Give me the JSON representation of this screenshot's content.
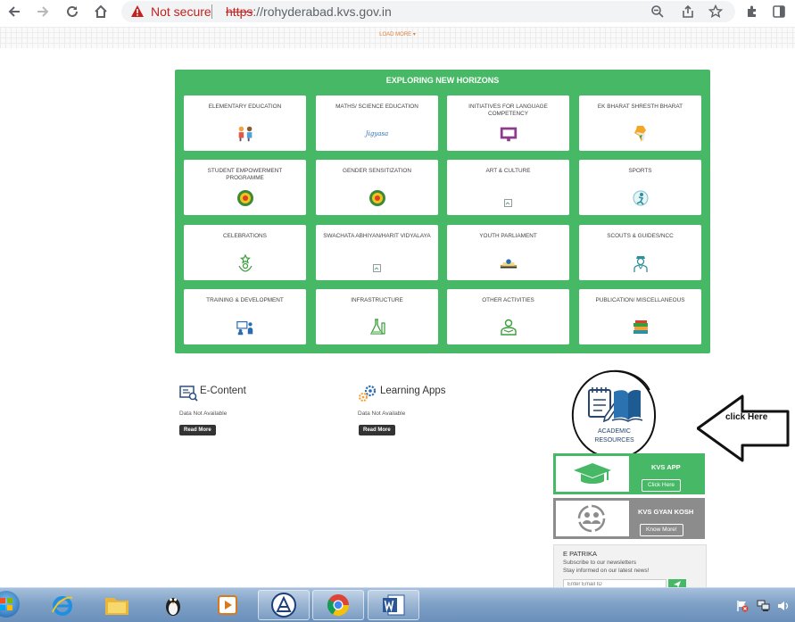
{
  "browser": {
    "security_label": "Not secure",
    "url_scheme": "https",
    "url_rest": "://rohyderabad.kvs.gov.in"
  },
  "load_more": "LOAD MORE ▾",
  "panel": {
    "title": "EXPLORING NEW HORIZONS",
    "cards": [
      {
        "label": "ELEMENTARY EDUCATION",
        "icon": "children-icon"
      },
      {
        "label": "MATHS/ SCIENCE EDUCATION",
        "icon": "jigyasa-logo-icon",
        "icon_text": "Jigyasa"
      },
      {
        "label": "INITIATIVES FOR LANGUAGE COMPETENCY",
        "icon": "language-board-icon"
      },
      {
        "label": "EK BHARAT SHRESTH BHARAT",
        "icon": "india-map-icon"
      },
      {
        "label": "STUDENT EMPOWERMENT PROGRAMME",
        "icon": "empowerment-emblem-icon"
      },
      {
        "label": "GENDER SENSITIZATION",
        "icon": "gender-emblem-icon"
      },
      {
        "label": "ART & CULTURE",
        "icon": "broken-image-icon"
      },
      {
        "label": "SPORTS",
        "icon": "sports-icon"
      },
      {
        "label": "CELEBRATIONS",
        "icon": "celebration-icon"
      },
      {
        "label": "SWACHATA ABHIYAN/HARIT VIDYALAYA",
        "icon": "broken-image-icon"
      },
      {
        "label": "YOUTH PARLIAMENT",
        "icon": "parliament-icon"
      },
      {
        "label": "SCOUTS & GUIDES/NCC",
        "icon": "scout-icon"
      },
      {
        "label": "TRAINING & DEVELOPMENT",
        "icon": "training-icon"
      },
      {
        "label": "INFRASTRUCTURE",
        "icon": "lab-flask-icon"
      },
      {
        "label": "OTHER ACTIVITIES",
        "icon": "reading-person-icon"
      },
      {
        "label": "PUBLICATION/ MISCELLANEOUS",
        "icon": "books-stack-icon"
      }
    ]
  },
  "econtent": {
    "title": "E-Content",
    "note": "Data Not Available",
    "button": "Read More"
  },
  "learning_apps": {
    "title": "Learning Apps",
    "note": "Data Not Available",
    "button": "Read More"
  },
  "academic": {
    "line1": "ACADEMIC",
    "line2": "RESOURCES"
  },
  "kvs_app": {
    "title": "KVS APP",
    "button": "Click Here",
    "color": "#47b866"
  },
  "gyan_kosh": {
    "title": "KVS GYAN KOSH",
    "button": "Know More!",
    "color": "#8c8c8c"
  },
  "epatrika": {
    "title": "E PATRIKA",
    "line1": "Subscribe to our newsletters",
    "line2": "Stay informed on our latest news!",
    "placeholder": "Enter Email ID"
  },
  "annotation": {
    "text": "click Here"
  }
}
